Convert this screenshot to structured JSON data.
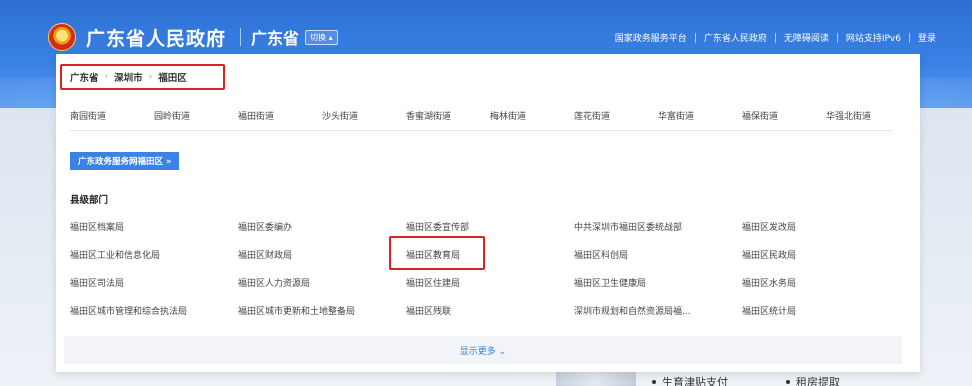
{
  "header": {
    "site_title": "广东省人民政府",
    "region": "广东省",
    "switch_label": "切换 ▴",
    "top_links": [
      "国家政务服务平台",
      "广东省人民政府",
      "无障碍阅读",
      "网站支持IPv6",
      "登录"
    ]
  },
  "breadcrumb": {
    "items": [
      "广东省",
      "深圳市",
      "福田区"
    ],
    "separator": "›"
  },
  "streets": [
    "南园街道",
    "园岭街道",
    "福田街道",
    "沙头街道",
    "香蜜湖街道",
    "梅林街道",
    "莲花街道",
    "华富街道",
    "福保街道",
    "华强北街道"
  ],
  "portal_button": "广东政务服务网福田区 »",
  "departments": {
    "title": "县级部门",
    "rows": [
      [
        "福田区档案局",
        "福田区委编办",
        "福田区委宣传部",
        "中共深圳市福田区委统战部",
        "福田区发改局"
      ],
      [
        "福田区工业和信息化局",
        "福田区财政局",
        "福田区教育局",
        "福田区科创局",
        "福田区民政局"
      ],
      [
        "福田区司法局",
        "福田区人力资源局",
        "福田区住建局",
        "福田区卫生健康局",
        "福田区水务局"
      ],
      [
        "福田区城市管理和综合执法局",
        "福田区城市更新和土地整备局",
        "福田区残联",
        "深圳市规划和自然资源局福...",
        "福田区统计局"
      ]
    ]
  },
  "more_label": "显示更多 ⌄",
  "background": {
    "items": [
      "生育津贴支付",
      "租房提取"
    ]
  },
  "colors": {
    "header_blue": "#2c6fd1",
    "accent_blue": "#3a82e4",
    "highlight_red": "#e02020"
  }
}
